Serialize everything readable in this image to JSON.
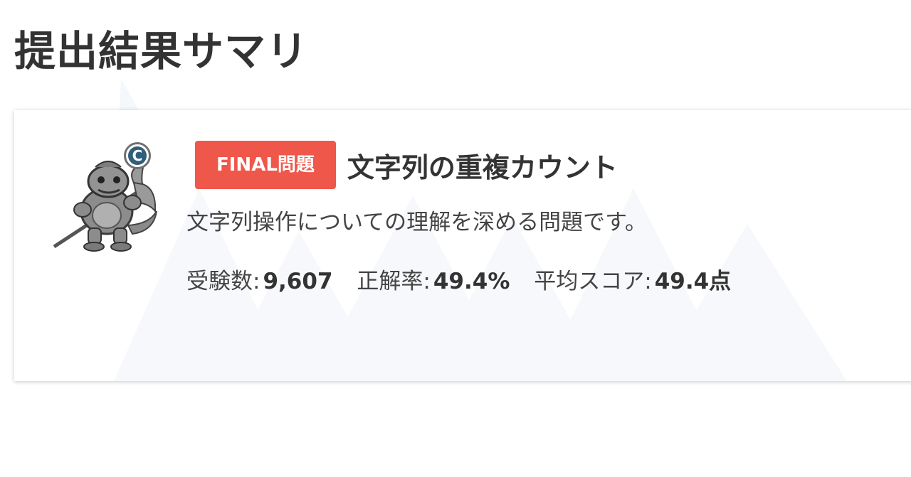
{
  "page": {
    "title": "提出結果サマリ"
  },
  "problem": {
    "badge_label": "FINAL問題",
    "title": "文字列の重複カウント",
    "description": "文字列操作についての理解を深める問題です。",
    "rank_letter": "C",
    "avatar_icon": "lizard-warrior-icon"
  },
  "stats": [
    {
      "label": "受験数:",
      "value": "9,607"
    },
    {
      "label": "正解率:",
      "value": "49.4%"
    },
    {
      "label": "平均スコア:",
      "value": "49.4点"
    }
  ],
  "colors": {
    "badge_bg": "#f0574b",
    "rank_badge_bg": "#2f5f7a",
    "title_text": "#333333",
    "background_pattern": "#f4f7fb"
  }
}
